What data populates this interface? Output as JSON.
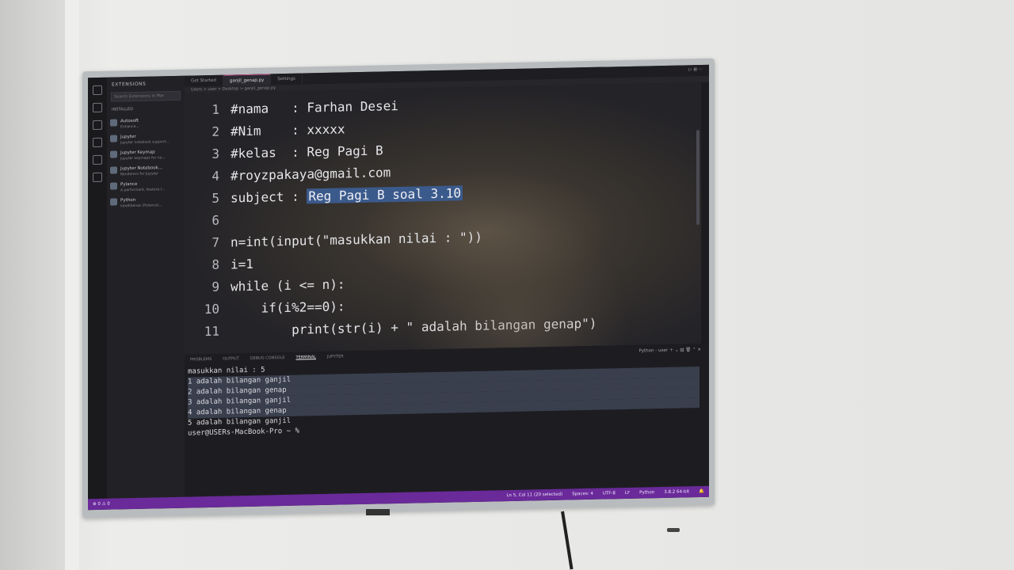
{
  "sidebar": {
    "title": "EXTENSIONS",
    "search_placeholder": "Search Extensions in Mar",
    "section": "INSTALLED",
    "extensions": [
      {
        "name": "Autosoft",
        "desc": "Enhance..."
      },
      {
        "name": "Jupyter",
        "desc": "Jupyter notebook support..."
      },
      {
        "name": "Jupyter Keymap",
        "desc": "Jupyter keymaps for no..."
      },
      {
        "name": "Jupyter Notebook...",
        "desc": "Renderers for Jupyter"
      },
      {
        "name": "Pylance",
        "desc": "A performant, feature-r..."
      },
      {
        "name": "Python",
        "desc": "IntelliSense (Pylance)..."
      }
    ]
  },
  "tabs": [
    {
      "label": "Get Started"
    },
    {
      "label": "ganjil_genap.py"
    },
    {
      "label": "Settings"
    }
  ],
  "breadcrumb": "Users > user > Desktop > ganjil_genap.py",
  "editor": {
    "lines": [
      {
        "n": "1",
        "code": "#nama   : Farhan Desei"
      },
      {
        "n": "2",
        "code": "#Nim    : xxxxx"
      },
      {
        "n": "3",
        "code": "#kelas  : Reg Pagi B"
      },
      {
        "n": "4",
        "code": "#royzpakaya@gmail.com"
      },
      {
        "n": "5",
        "code": "subject : ",
        "selected": "Reg Pagi B soal 3.10"
      },
      {
        "n": "6",
        "code": ""
      },
      {
        "n": "7",
        "code": "n=int(input(\"masukkan nilai : \"))"
      },
      {
        "n": "8",
        "code": "i=1"
      },
      {
        "n": "9",
        "code": "while (i <= n):"
      },
      {
        "n": "10",
        "code": "    if(i%2==0):"
      },
      {
        "n": "11",
        "code": "        print(str(i) + \" adalah bilangan genap\")"
      }
    ]
  },
  "panel": {
    "tabs": [
      "PROBLEMS",
      "OUTPUT",
      "DEBUG CONSOLE",
      "TERMINAL",
      "JUPYTER"
    ],
    "active_tab": "TERMINAL",
    "terminal_label": "Python - user",
    "terminal_lines": [
      "masukkan nilai : 5",
      "1 adalah bilangan ganjil",
      "2 adalah bilangan genap",
      "3 adalah bilangan ganjil",
      "4 adalah bilangan genap",
      "5 adalah bilangan ganjil",
      "user@USERs-MacBook-Pro ~ % "
    ]
  },
  "statusbar": {
    "left": "⊗ 0 ⚠ 0",
    "cursor": "Ln 5, Col 11 (20 selected)",
    "spaces": "Spaces: 4",
    "encoding": "UTF-8",
    "eol": "LF",
    "language": "Python",
    "interpreter": "3.8.2 64-bit"
  },
  "colors": {
    "status_bar": "#6a2a9a",
    "selection": "#3b5a8c",
    "editor_bg": "#242327"
  }
}
